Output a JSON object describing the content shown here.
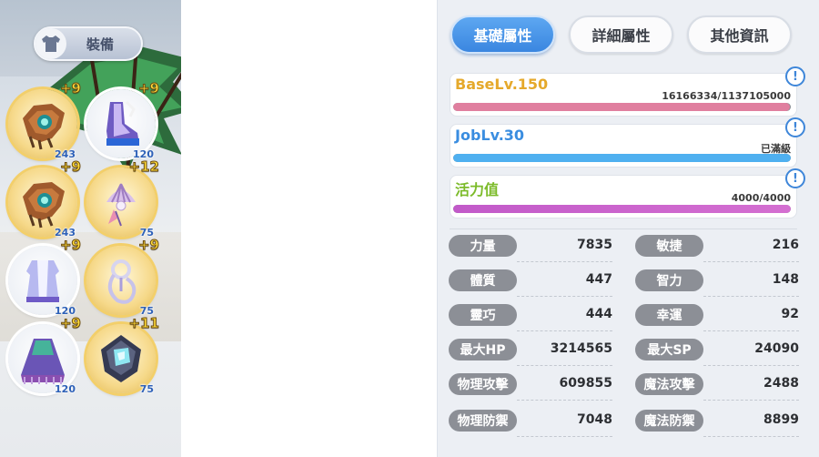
{
  "equipment": {
    "header_label": "裝備",
    "slots": [
      {
        "name": "helmet",
        "refine": "+9",
        "level": "243",
        "frame": "gold"
      },
      {
        "name": "boots",
        "refine": "+9",
        "level": "120",
        "frame": "white"
      },
      {
        "name": "mask",
        "refine": "+9",
        "level": "243",
        "frame": "gold"
      },
      {
        "name": "shell-accessory",
        "refine": "+12",
        "level": "75",
        "frame": "gold"
      },
      {
        "name": "robe",
        "refine": "+9",
        "level": "120",
        "frame": "white"
      },
      {
        "name": "amulet",
        "refine": "+9",
        "level": "75",
        "frame": "gold"
      },
      {
        "name": "cloak",
        "refine": "+9",
        "level": "120",
        "frame": "white"
      },
      {
        "name": "crystal",
        "refine": "+11",
        "level": "75",
        "frame": "gold"
      }
    ]
  },
  "tabs": [
    {
      "label": "基礎屬性",
      "active": true
    },
    {
      "label": "詳細屬性",
      "active": false
    },
    {
      "label": "其他資訊",
      "active": false
    }
  ],
  "bars": {
    "base": {
      "title": "BaseLv.150",
      "value": "16166334/1137105000",
      "fill": 0.998,
      "color": "#e5a92b",
      "bar_color": "#e07f9f"
    },
    "job": {
      "title": "JobLv.30",
      "value": "已滿級",
      "fill": 1.0,
      "color": "#3a8de0",
      "bar_color": "#4fb0f0"
    },
    "vitality": {
      "title": "活力值",
      "value": "4000/4000",
      "fill": 1.0,
      "color": "#7cbb2a",
      "bar_color": "#c25ac9"
    }
  },
  "info_icon": "!",
  "stats": [
    {
      "label": "力量",
      "value": "7835"
    },
    {
      "label": "敏捷",
      "value": "216"
    },
    {
      "label": "體質",
      "value": "447"
    },
    {
      "label": "智力",
      "value": "148"
    },
    {
      "label": "靈巧",
      "value": "444"
    },
    {
      "label": "幸運",
      "value": "92"
    },
    {
      "label": "最大HP",
      "value": "3214565"
    },
    {
      "label": "最大SP",
      "value": "24090"
    },
    {
      "label": "物理攻擊",
      "value": "609855"
    },
    {
      "label": "魔法攻擊",
      "value": "2488"
    },
    {
      "label": "物理防禦",
      "value": "7048"
    },
    {
      "label": "魔法防禦",
      "value": "8899"
    }
  ]
}
